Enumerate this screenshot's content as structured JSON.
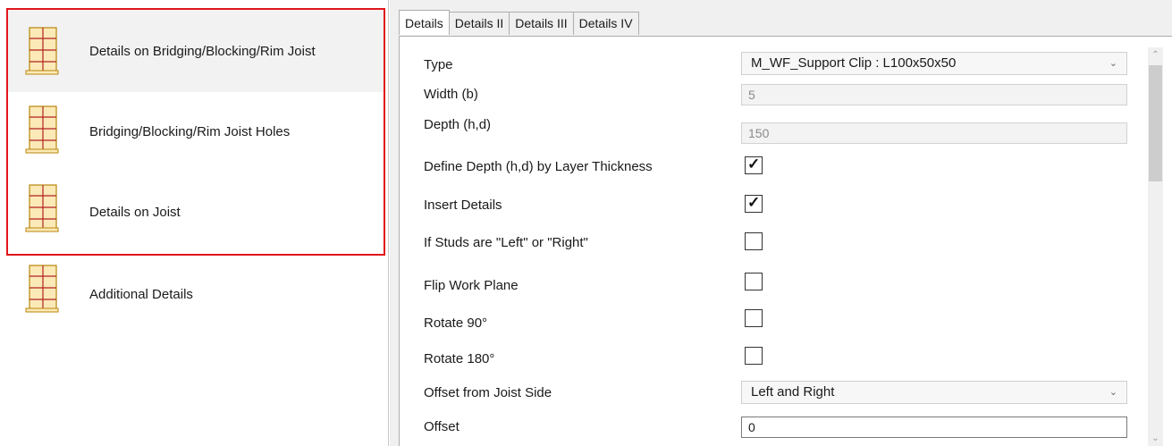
{
  "left_panel": {
    "items": [
      {
        "label": "Details on Bridging/Blocking/Rim Joist",
        "icon": "joist-layout-icon",
        "selected": true
      },
      {
        "label": "Bridging/Blocking/Rim Joist Holes",
        "icon": "joist-layout-icon",
        "selected": false
      },
      {
        "label": "Details on Joist",
        "icon": "joist-layout-icon",
        "selected": false
      },
      {
        "label": "Additional Details",
        "icon": "joist-layout-icon",
        "selected": false
      }
    ],
    "highlight_color": "#e0161b"
  },
  "tabs": [
    {
      "label": "Details",
      "active": true
    },
    {
      "label": "Details II",
      "active": false
    },
    {
      "label": "Details III",
      "active": false
    },
    {
      "label": "Details IV",
      "active": false
    }
  ],
  "properties": {
    "type": {
      "label": "Type",
      "value": "M_WF_Support Clip : L100x50x50"
    },
    "width": {
      "label": "Width (b)",
      "value": "5"
    },
    "depth": {
      "label": "Depth (h,d)",
      "value": "150"
    },
    "define_depth": {
      "label": "Define Depth (h,d) by Layer Thickness",
      "checked": true
    },
    "insert_details": {
      "label": "Insert Details",
      "checked": true
    },
    "studs_left_right": {
      "label": "If Studs are \"Left\" or \"Right\"",
      "checked": false
    },
    "flip_work_plane": {
      "label": "Flip Work Plane",
      "checked": false
    },
    "rotate_90": {
      "label": "Rotate 90°",
      "checked": false
    },
    "rotate_180": {
      "label": "Rotate 180°",
      "checked": false
    },
    "offset_side": {
      "label": "Offset from Joist Side",
      "value": "Left and Right"
    },
    "offset": {
      "label": "Offset",
      "value": "0"
    }
  },
  "glyphs": {
    "check": "✓",
    "chevron_down": "⌄",
    "chevron_up": "⌃"
  }
}
